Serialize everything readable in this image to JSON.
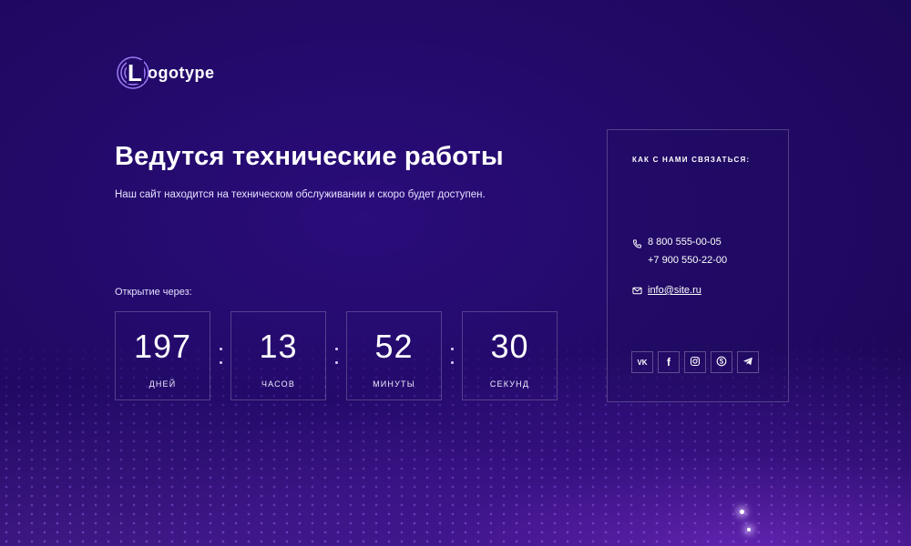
{
  "logo": {
    "text": "ogotype",
    "letter": "L"
  },
  "hero": {
    "title": "Ведутся технические работы",
    "subtitle": "Наш сайт находится на техническом обслуживании и скоро будет доступен."
  },
  "countdown": {
    "label": "Открытие через:",
    "items": [
      {
        "value": "197",
        "unit": "ДНЕЙ"
      },
      {
        "value": "13",
        "unit": "ЧАСОВ"
      },
      {
        "value": "52",
        "unit": "МИНУТЫ"
      },
      {
        "value": "30",
        "unit": "СЕКУНД"
      }
    ]
  },
  "contacts": {
    "heading": "КАК С НАМИ СВЯЗАТЬСЯ:",
    "phones": [
      "8 800 555-00-05",
      "+7 900 550-22-00"
    ],
    "email": "info@site.ru",
    "socials": [
      {
        "name": "vk",
        "label": "VK"
      },
      {
        "name": "facebook",
        "label": "f"
      },
      {
        "name": "instagram",
        "label": ""
      },
      {
        "name": "skype",
        "label": ""
      },
      {
        "name": "telegram",
        "label": ""
      }
    ]
  },
  "colors": {
    "background": "#220a68",
    "accent_glow": "#a03cff",
    "text": "#ffffff"
  }
}
